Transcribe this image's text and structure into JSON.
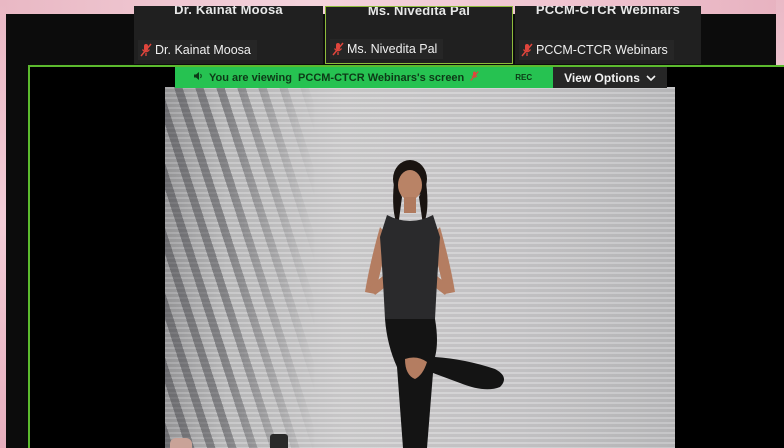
{
  "participants": [
    {
      "display_name": "Dr. Kainat Moosa",
      "tag_name": "Dr. Kainat Moosa",
      "muted_icon": "mic-muted-icon"
    },
    {
      "display_name": "Ms. Nivedita Pal",
      "tag_name": "Ms. Nivedita Pal",
      "muted_icon": "mic-muted-icon"
    },
    {
      "display_name": "PCCM-CTCR Webinars",
      "tag_name": "PCCM-CTCR Webinars",
      "muted_icon": "mic-muted-icon"
    }
  ],
  "share_banner": {
    "text": "You are viewing  PCCM-CTCR Webinars's screen",
    "rec_label": "REC",
    "speaker_icon": "speaker-icon"
  },
  "view_options": {
    "label": "View Options",
    "icon": "chevron-down-icon"
  },
  "colors": {
    "accent_green": "#26c251",
    "active_border": "#5cba2e",
    "muted_red": "#e0453c"
  }
}
